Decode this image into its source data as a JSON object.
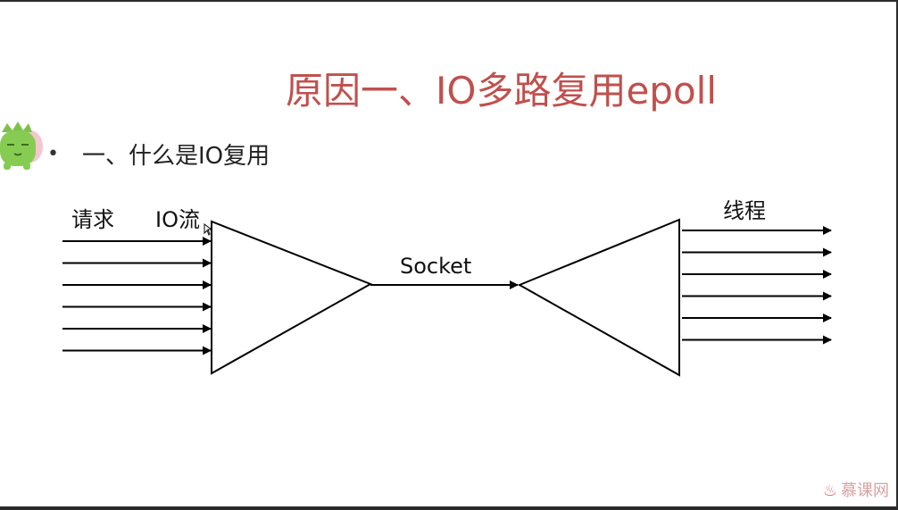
{
  "slide": {
    "title": "原因一、IO多路复用epoll",
    "bullet": "一、什么是IO复用"
  },
  "diagram": {
    "left_label": "请求",
    "stream_label": "IO流",
    "middle_label": "Socket",
    "right_label": "线程",
    "input_arrow_count": 6,
    "output_arrow_count": 6
  },
  "branding": {
    "logo_text": "慕课网"
  },
  "colors": {
    "title": "#c0504d",
    "slide_bg": "#ffffff",
    "frame": "#2b2b2b"
  }
}
